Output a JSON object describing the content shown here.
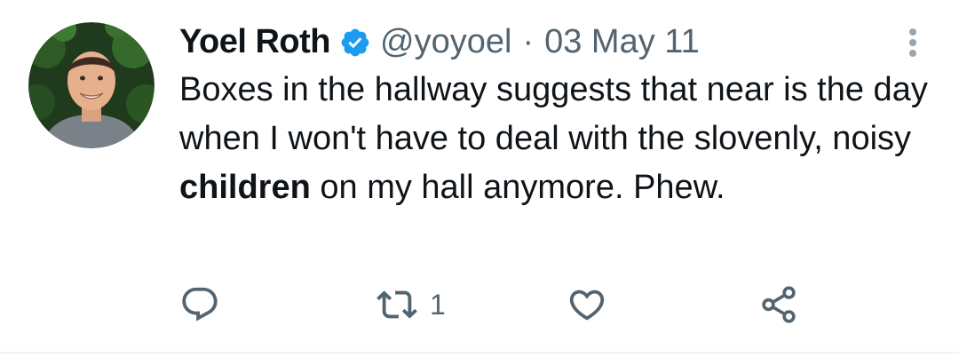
{
  "tweet": {
    "author_name": "Yoel Roth",
    "handle": "@yoyoel",
    "separator": "·",
    "date": "03 May 11",
    "text_before": "Boxes in the hallway suggests that near is the day when I won't have to deal with the slovenly, noisy ",
    "text_bold": "children",
    "text_after": " on my hall anymore. Phew.",
    "retweet_count": "1",
    "icons": [
      "verified-badge-icon",
      "more-icon",
      "reply-icon",
      "retweet-icon",
      "like-icon",
      "share-icon"
    ],
    "colors": {
      "verified": "#1d9bf0",
      "secondary_text": "#536471",
      "primary_text": "#0f1419"
    }
  }
}
